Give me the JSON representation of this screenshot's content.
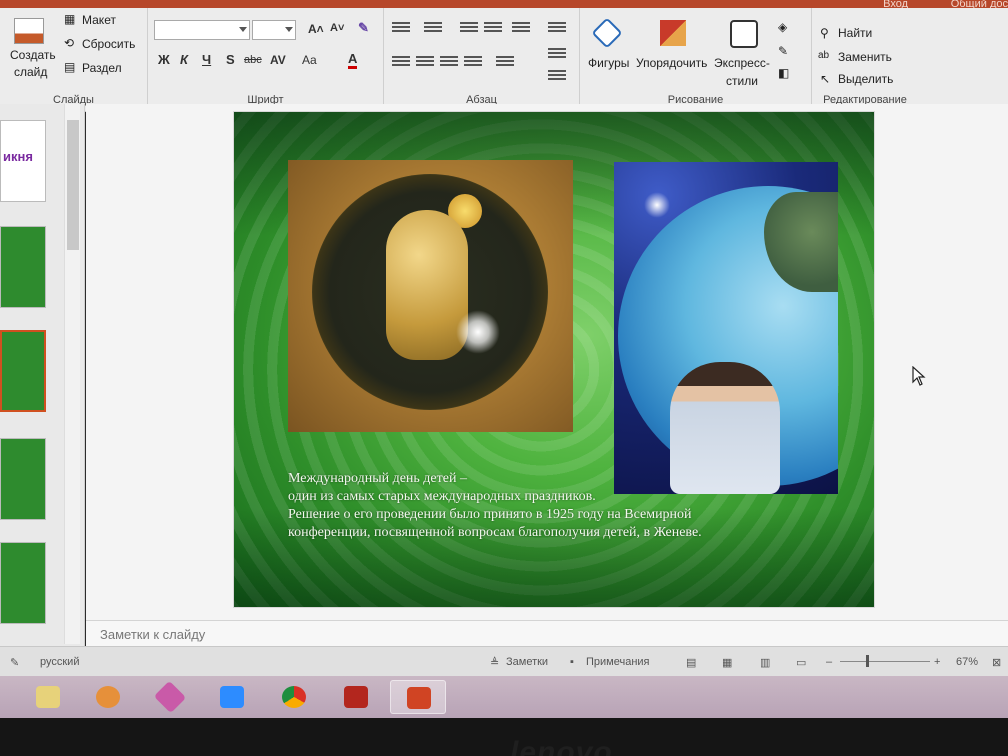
{
  "titlebar": {
    "login": "Вход",
    "share": "Общий дос"
  },
  "ribbon": {
    "slides_group": {
      "label": "Слайды",
      "create_slide": "Создать",
      "create_slide2": "слайд",
      "layout": "Макет",
      "reset": "Сбросить",
      "section": "Раздел"
    },
    "font_group": {
      "label": "Шрифт",
      "bold": "Ж",
      "italic": "К",
      "underline": "Ч",
      "shadow": "S",
      "strike": "abc",
      "spacing": "AV",
      "case": "Aa",
      "color": "A"
    },
    "paragraph_group": {
      "label": "Абзац"
    },
    "drawing_group": {
      "label": "Рисование",
      "shapes": "Фигуры",
      "arrange": "Упорядочить",
      "styles": "Экспресс-",
      "styles2": "стили"
    },
    "editing_group": {
      "label": "Редактирование",
      "find": "Найти",
      "replace": "Заменить",
      "select": "Выделить"
    }
  },
  "thumbnails": {
    "first_thumb_text": "икня"
  },
  "slide": {
    "caption_lines": [
      "Международный день детей –",
      "один из самых старых международных праздников.",
      "Решение о его проведении было принято в 1925 году на Всемирной",
      "конференции, посвященной вопросам благополучия детей, в Женеве."
    ]
  },
  "notes": {
    "placeholder": "Заметки к слайду"
  },
  "status": {
    "language": "русский",
    "notes_btn": "Заметки",
    "comments_btn": "Примечания",
    "zoom": "67%"
  },
  "bezel": {
    "brand": "lenovo"
  },
  "colors": {
    "accent": "#b7472a",
    "slide_green": "#3fa436"
  }
}
